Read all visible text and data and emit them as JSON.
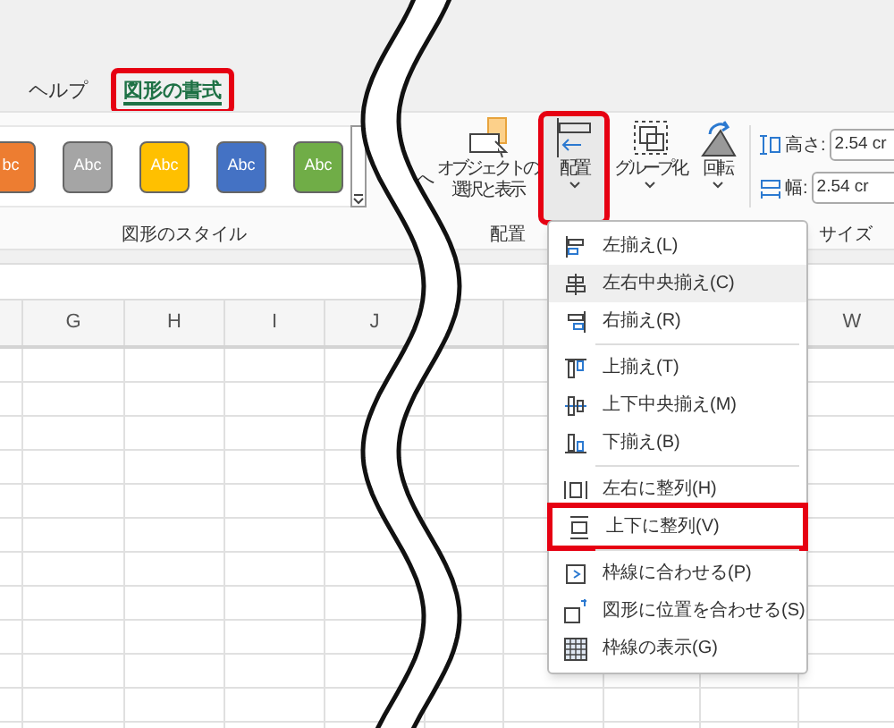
{
  "ribbon_tabs": [
    {
      "label": "ヘルプ",
      "selected": false,
      "highlighted": false
    },
    {
      "label": "図形の書式",
      "selected": true,
      "highlighted": true
    }
  ],
  "shape_styles": {
    "swatches": [
      {
        "label": "bc",
        "color": "#ed7d31"
      },
      {
        "label": "Abc",
        "color": "#a5a5a5"
      },
      {
        "label": "Abc",
        "color": "#ffc000"
      },
      {
        "label": "Abc",
        "color": "#4472c4"
      },
      {
        "label": "Abc",
        "color": "#70ad47"
      }
    ],
    "group_label": "図形のスタイル"
  },
  "cut_fragment": "へ",
  "arrange": {
    "buttons": [
      {
        "lines": [
          "オブジェクトの",
          "選択と表示"
        ],
        "highlighted": false,
        "dropdown": false
      },
      {
        "lines": [
          "配置"
        ],
        "highlighted": true,
        "dropdown": true
      },
      {
        "lines": [
          "グループ化"
        ],
        "highlighted": false,
        "dropdown": true
      },
      {
        "lines": [
          "回転"
        ],
        "highlighted": false,
        "dropdown": true
      }
    ],
    "group_label": "配置"
  },
  "size": {
    "fields": [
      {
        "label": "高さ:",
        "value": "2.54 cr"
      },
      {
        "label": "幅:",
        "value": "2.54 cr"
      }
    ],
    "group_label": "サイズ"
  },
  "columns": [
    "G",
    "H",
    "I",
    "J",
    "W"
  ],
  "menu": [
    {
      "label": "左揃え(L)",
      "selected": false,
      "highlighted": false,
      "separator_after": false
    },
    {
      "label": "左右中央揃え(C)",
      "selected": true,
      "highlighted": false,
      "separator_after": false
    },
    {
      "label": "右揃え(R)",
      "selected": false,
      "highlighted": false,
      "separator_after": true
    },
    {
      "label": "上揃え(T)",
      "selected": false,
      "highlighted": false,
      "separator_after": false
    },
    {
      "label": "上下中央揃え(M)",
      "selected": false,
      "highlighted": false,
      "separator_after": false
    },
    {
      "label": "下揃え(B)",
      "selected": false,
      "highlighted": false,
      "separator_after": true
    },
    {
      "label": "左右に整列(H)",
      "selected": false,
      "highlighted": false,
      "separator_after": false
    },
    {
      "label": "上下に整列(V)",
      "selected": false,
      "highlighted": true,
      "separator_after": true
    },
    {
      "label": "枠線に合わせる(P)",
      "selected": false,
      "highlighted": false,
      "separator_after": false
    },
    {
      "label": "図形に位置を合わせる(S)",
      "selected": false,
      "highlighted": false,
      "separator_after": false
    },
    {
      "label": "枠線の表示(G)",
      "selected": false,
      "highlighted": false,
      "separator_after": false
    }
  ]
}
